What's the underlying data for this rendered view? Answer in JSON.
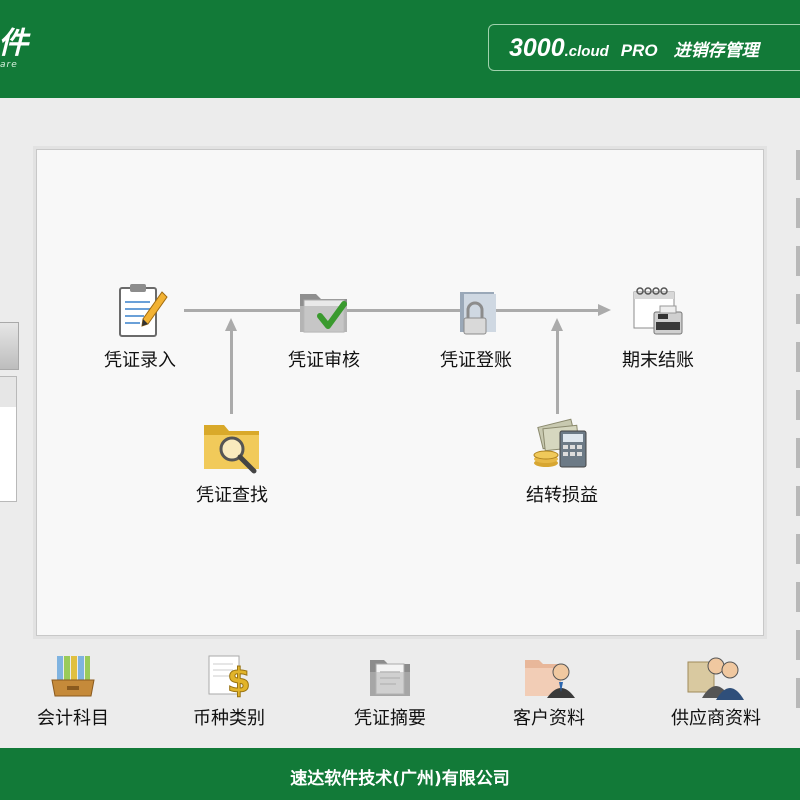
{
  "header": {
    "logo_char": "件",
    "logo_sub": "are",
    "product_name": "3000",
    "product_suffix": ".cloud",
    "product_edition": "PRO",
    "product_module": "进销存管理"
  },
  "flow": {
    "voucher_entry": "凭证录入",
    "voucher_audit": "凭证审核",
    "voucher_posting": "凭证登账",
    "period_close": "期末结账",
    "voucher_search": "凭证查找",
    "profit_transfer": "结转损益"
  },
  "toolbar": {
    "accounts": "会计科目",
    "currency": "币种类别",
    "summary": "凭证摘要",
    "customers": "客户资料",
    "suppliers": "供应商资料"
  },
  "footer": {
    "company": "速达软件技术(广州)有限公司"
  },
  "colors": {
    "brand_green": "#127a38",
    "connector_gray": "#ababab",
    "panel_bg": "#f8f8f8"
  }
}
